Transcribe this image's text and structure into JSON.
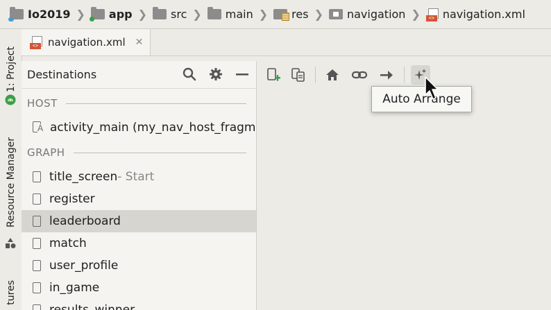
{
  "breadcrumb": [
    {
      "label": "Io2019",
      "icon": "project-folder-icon",
      "bold": true
    },
    {
      "label": "app",
      "icon": "module-folder-icon",
      "bold": true
    },
    {
      "label": "src",
      "icon": "folder-icon",
      "bold": false
    },
    {
      "label": "main",
      "icon": "folder-icon",
      "bold": false
    },
    {
      "label": "res",
      "icon": "res-folder-icon",
      "bold": false
    },
    {
      "label": "navigation",
      "icon": "navigation-folder-icon",
      "bold": false
    },
    {
      "label": "navigation.xml",
      "icon": "xml-file-icon",
      "bold": false
    }
  ],
  "toolstrip": {
    "project_tab": "1: Project",
    "resource_manager_tab": "Resource Manager",
    "partial_tab": "tures"
  },
  "editor_tab": {
    "label": "navigation.xml",
    "close": "✕"
  },
  "destinations": {
    "title": "Destinations",
    "host_header": "HOST",
    "host_items": [
      {
        "label": "activity_main (my_nav_host_fragment)"
      }
    ],
    "graph_header": "GRAPH",
    "graph_items": [
      {
        "label": "title_screen",
        "suffix": " - Start",
        "selected": false
      },
      {
        "label": "register",
        "suffix": "",
        "selected": false
      },
      {
        "label": "leaderboard",
        "suffix": "",
        "selected": true
      },
      {
        "label": "match",
        "suffix": "",
        "selected": false
      },
      {
        "label": "user_profile",
        "suffix": "",
        "selected": false
      },
      {
        "label": "in_game",
        "suffix": "",
        "selected": false
      },
      {
        "label": "results_winner",
        "suffix": "",
        "selected": false
      }
    ]
  },
  "toolbar": {
    "buttons": [
      "new-destination-icon",
      "copy-destination-icon",
      "home-icon",
      "link-icon",
      "action-arrow-icon",
      "auto-arrange-icon"
    ]
  },
  "tooltip": {
    "text": "Auto Arrange"
  },
  "colors": {
    "background": "#ecebe6",
    "panel": "#f5f4f0",
    "selection": "#d6d5d0",
    "xml_badge": "#d35536",
    "android_green": "#3c9e48"
  }
}
